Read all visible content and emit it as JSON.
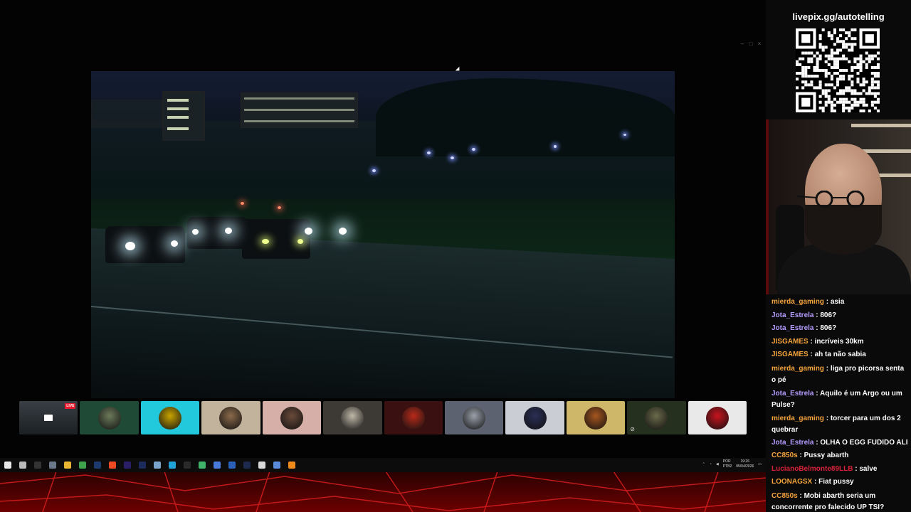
{
  "overlay": {
    "livepix_text": "livepix.gg/autotelling"
  },
  "window_controls": {
    "minimize": "–",
    "maximize": "□",
    "close": "×"
  },
  "colors": {
    "chat_orange": "#f5a43c",
    "chat_purple": "#b49cff",
    "chat_red": "#d9223a",
    "live_badge": "#e9192e"
  },
  "thumbnails": [
    {
      "name": "stream-preview",
      "bg": "#2b3036",
      "live": "LIVE"
    },
    {
      "name": "participant-2",
      "bg": "#1f4a36",
      "avatar": "#6b7a5a"
    },
    {
      "name": "participant-3",
      "bg": "#22c9dd",
      "avatar": "#c8a300"
    },
    {
      "name": "participant-4",
      "bg": "#c2b39c",
      "avatar": "#8a6a4a"
    },
    {
      "name": "participant-5",
      "bg": "#d6b0a8",
      "avatar": "#6a4a3a"
    },
    {
      "name": "participant-6",
      "bg": "#3d3a36",
      "avatar": "#bfb8a8"
    },
    {
      "name": "participant-7",
      "bg": "#3a1010",
      "avatar": "#b82a1a"
    },
    {
      "name": "participant-8",
      "bg": "#5d6270",
      "avatar": "#9aa0aa"
    },
    {
      "name": "participant-9",
      "bg": "#cbcdd5",
      "avatar": "#2a2f55"
    },
    {
      "name": "participant-10",
      "bg": "#cfb76a",
      "avatar": "#a5561f"
    },
    {
      "name": "participant-11",
      "bg": "#26301e",
      "avatar": "#6a6a4a",
      "muted": true
    },
    {
      "name": "participant-12",
      "bg": "#e9e9e9",
      "avatar": "#c8141e"
    }
  ],
  "taskbar": {
    "icons": [
      {
        "name": "windows-start-icon",
        "color": "#e9e9e9"
      },
      {
        "name": "task-view-icon",
        "color": "#bbbbbb"
      },
      {
        "name": "obs-icon",
        "color": "#333333"
      },
      {
        "name": "steam-icon",
        "color": "#6a7a8a"
      },
      {
        "name": "file-explorer-icon",
        "color": "#e8b632"
      },
      {
        "name": "chrome-icon",
        "color": "#3fa34d"
      },
      {
        "name": "photoshop-icon",
        "color": "#1c3a6e"
      },
      {
        "name": "brave-icon",
        "color": "#f04a24"
      },
      {
        "name": "premiere-icon",
        "color": "#2a1f66"
      },
      {
        "name": "media-encoder-icon",
        "color": "#1d2a5e"
      },
      {
        "name": "notes-icon",
        "color": "#7aa3c9"
      },
      {
        "name": "edge-icon",
        "color": "#1fa3d8"
      },
      {
        "name": "app-icon",
        "color": "#2a2a2a"
      },
      {
        "name": "maps-icon",
        "color": "#3fb36a"
      },
      {
        "name": "chat-icon",
        "color": "#4a7ad9"
      },
      {
        "name": "word-icon",
        "color": "#2b5fb8"
      },
      {
        "name": "audition-icon",
        "color": "#1d2a4e"
      },
      {
        "name": "capcut-icon",
        "color": "#d9d9d9"
      },
      {
        "name": "network-app-icon",
        "color": "#5a8ad9"
      },
      {
        "name": "vlc-icon",
        "color": "#f08a1a"
      }
    ],
    "lang_top": "POR",
    "lang_bottom": "PTB2",
    "time": "19:26",
    "date": "05/04/2026"
  },
  "chat": [
    {
      "user": "mierda_gaming",
      "color": "#f5a43c",
      "text": "asia"
    },
    {
      "user": "Jota_Estrela",
      "color": "#b49cff",
      "text": "806?"
    },
    {
      "user": "Jota_Estrela",
      "color": "#b49cff",
      "text": "806?"
    },
    {
      "user": "JISGAMES",
      "color": "#f5a43c",
      "text": "incríveis 30km"
    },
    {
      "user": "JISGAMES",
      "color": "#f5a43c",
      "text": "ah ta não sabia"
    },
    {
      "user": "mierda_gaming",
      "color": "#f5a43c",
      "text": "liga pro picorsa senta o pé",
      "wrap": true
    },
    {
      "user": "Jota_Estrela",
      "color": "#b49cff",
      "text": "Aquilo é um Argo ou um Pulse?",
      "wrap": true
    },
    {
      "user": "mierda_gaming",
      "color": "#f5a43c",
      "text": "torcer para um dos 2 quebrar",
      "wrap": true
    },
    {
      "user": "Jota_Estrela",
      "color": "#b49cff",
      "text": "OLHA O EGG FUDIDO ALI"
    },
    {
      "user": "CC850s",
      "color": "#f5a43c",
      "text": "Pussy abarth"
    },
    {
      "user": "LucianoBelmonte89LLB",
      "color": "#d9223a",
      "text": "salve"
    },
    {
      "user": "LOONAGSX",
      "color": "#f5a43c",
      "text": "Fiat pussy"
    },
    {
      "user": "CC850s",
      "color": "#f5a43c",
      "text": "Mobi abarth seria um concorrente pro falecido UP TSI?",
      "wrap": true
    }
  ]
}
